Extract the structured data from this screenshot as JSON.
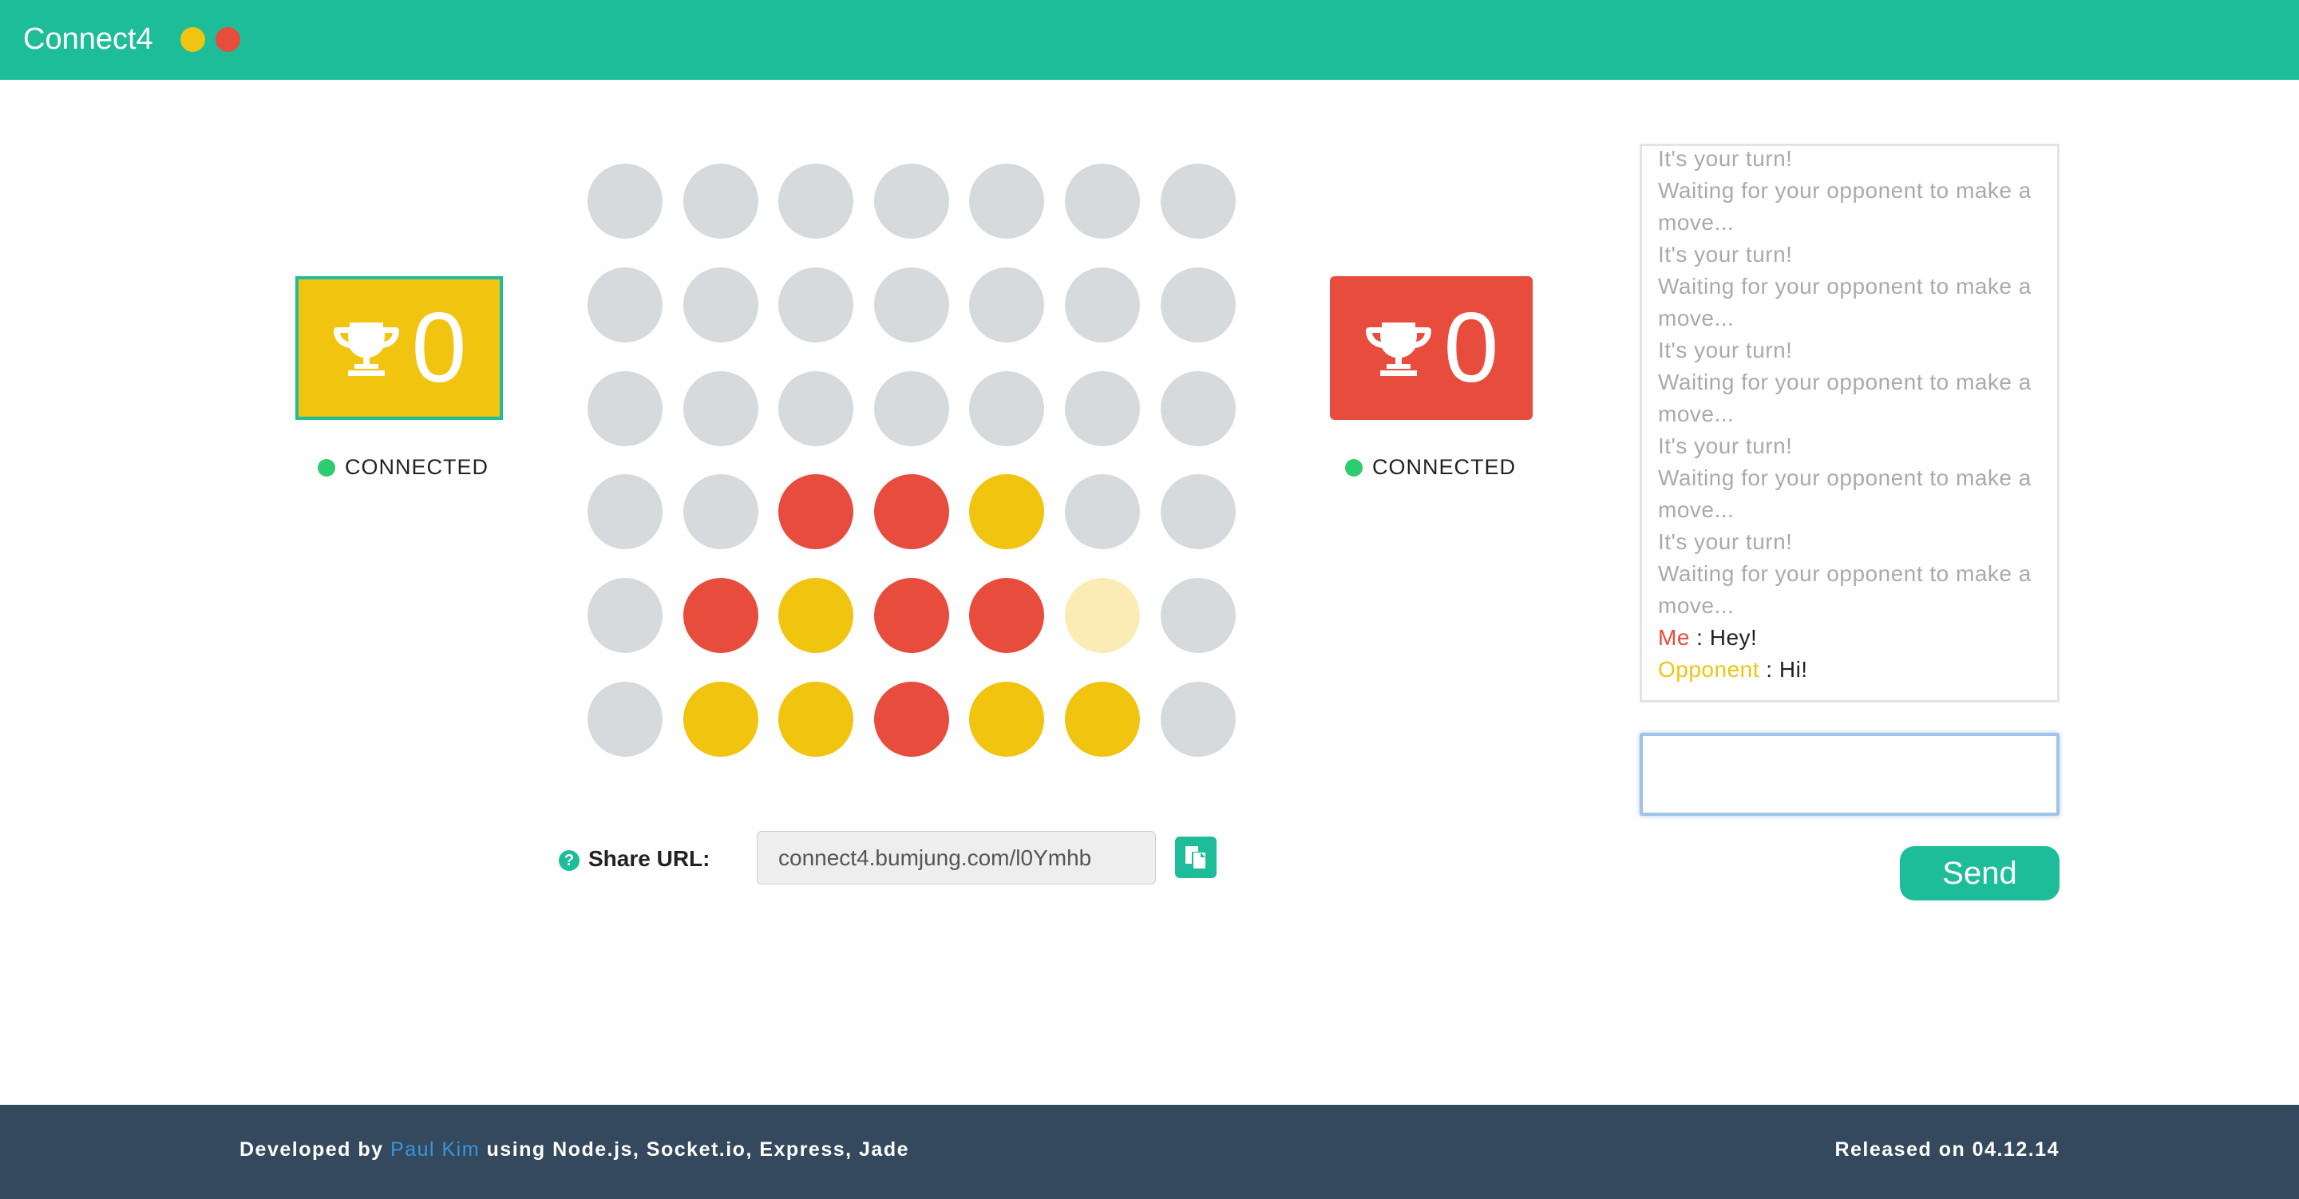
{
  "header": {
    "title": "Connect4",
    "dots": [
      {
        "color": "#f1c40f",
        "label": "yellow-player-dot"
      },
      {
        "color": "#e74c3c",
        "label": "red-player-dot"
      }
    ]
  },
  "players": {
    "left": {
      "score": "0",
      "status": "CONNECTED",
      "color": "#f1c40f",
      "icon": "trophy-icon"
    },
    "right": {
      "score": "0",
      "status": "CONNECTED",
      "color": "#e74c3c",
      "icon": "trophy-icon"
    }
  },
  "board": {
    "columns": 7,
    "rows": 6,
    "colors": {
      "empty": "#d7dadd",
      "red": "#e74c3c",
      "yellow": "#f1c40f",
      "ghost": "#fbecb5"
    },
    "cells": [
      [
        "empty",
        "empty",
        "empty",
        "empty",
        "empty",
        "empty",
        "empty"
      ],
      [
        "empty",
        "empty",
        "empty",
        "empty",
        "empty",
        "empty",
        "empty"
      ],
      [
        "empty",
        "empty",
        "empty",
        "empty",
        "empty",
        "empty",
        "empty"
      ],
      [
        "empty",
        "empty",
        "red",
        "red",
        "yellow",
        "empty",
        "empty"
      ],
      [
        "empty",
        "red",
        "yellow",
        "red",
        "red",
        "ghost",
        "empty"
      ],
      [
        "empty",
        "yellow",
        "yellow",
        "red",
        "yellow",
        "yellow",
        "empty"
      ]
    ]
  },
  "share": {
    "help_icon": "?",
    "label": "Share URL:",
    "url": "connect4.bumjung.com/l0Ymhb",
    "copy_icon": "copy-icon"
  },
  "chat": {
    "log": [
      "It's your turn!",
      "Waiting for your opponent to make a move...",
      "It's your turn!",
      "Waiting for your opponent to make a move...",
      "It's your turn!",
      "Waiting for your opponent to make a move...",
      "It's your turn!",
      "Waiting for your opponent to make a move...",
      "It's your turn!",
      "Waiting for your opponent to make a move..."
    ],
    "messages": [
      {
        "sender": "Me",
        "text": "Hey!"
      },
      {
        "sender": "Opponent",
        "text": "Hi!"
      }
    ],
    "separator": " : ",
    "input_value": "",
    "send_label": "Send"
  },
  "footer": {
    "developed_by": "Developed by",
    "author": "Paul Kim",
    "tech": "using Node.js, Socket.io, Express, Jade",
    "released": "Released on 04.12.14"
  }
}
